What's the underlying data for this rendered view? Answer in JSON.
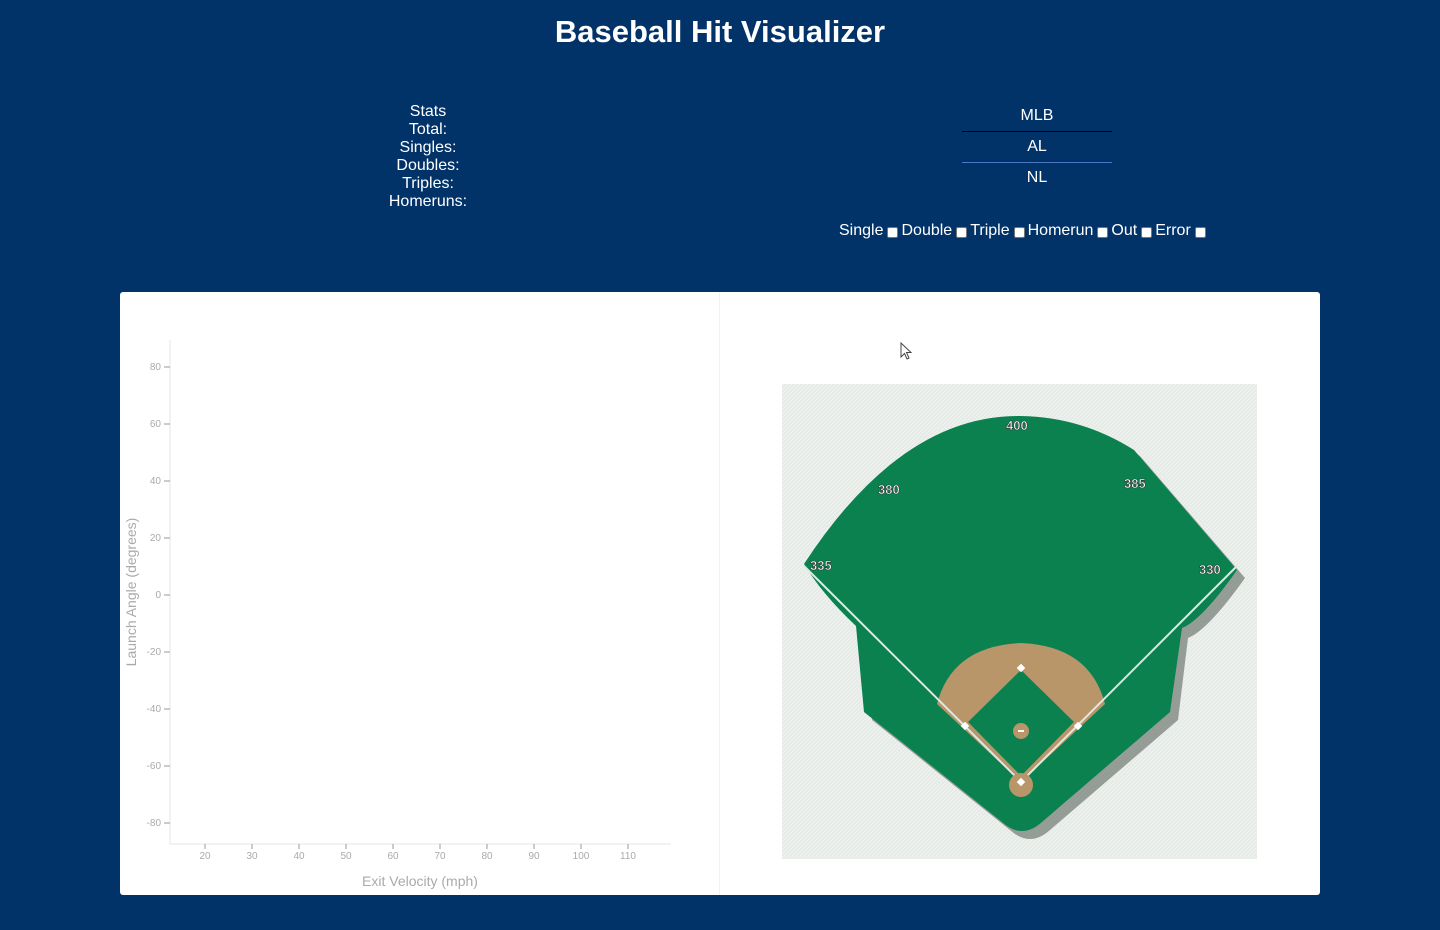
{
  "app": {
    "title": "Baseball Hit Visualizer"
  },
  "stats": {
    "heading": "Stats",
    "total_label": "Total:",
    "singles_label": "Singles:",
    "doubles_label": "Doubles:",
    "triples_label": "Triples:",
    "homeruns_label": "Homeruns:"
  },
  "league_menu": {
    "items": [
      "MLB",
      "AL",
      "NL"
    ]
  },
  "filters": {
    "items": [
      {
        "label": "Single",
        "checked": false
      },
      {
        "label": "Double",
        "checked": false
      },
      {
        "label": "Triple",
        "checked": false
      },
      {
        "label": "Homerun",
        "checked": false
      },
      {
        "label": "Out",
        "checked": false
      },
      {
        "label": "Error",
        "checked": false
      }
    ]
  },
  "chart_data": {
    "type": "scatter",
    "xlabel": "Exit Velocity (mph)",
    "ylabel": "Launch Angle (degrees)",
    "x_ticks": [
      20,
      30,
      40,
      50,
      60,
      70,
      80,
      90,
      100,
      110
    ],
    "y_ticks": [
      80,
      60,
      40,
      20,
      0,
      -20,
      -40,
      -60,
      -80
    ],
    "points": []
  },
  "field": {
    "distances": {
      "left_line": "335",
      "left_center": "380",
      "center": "400",
      "right_center": "385",
      "right_line": "330"
    },
    "colors": {
      "grass": "#0c8150",
      "dirt": "#b9956a",
      "background": "#edf1ee"
    }
  }
}
